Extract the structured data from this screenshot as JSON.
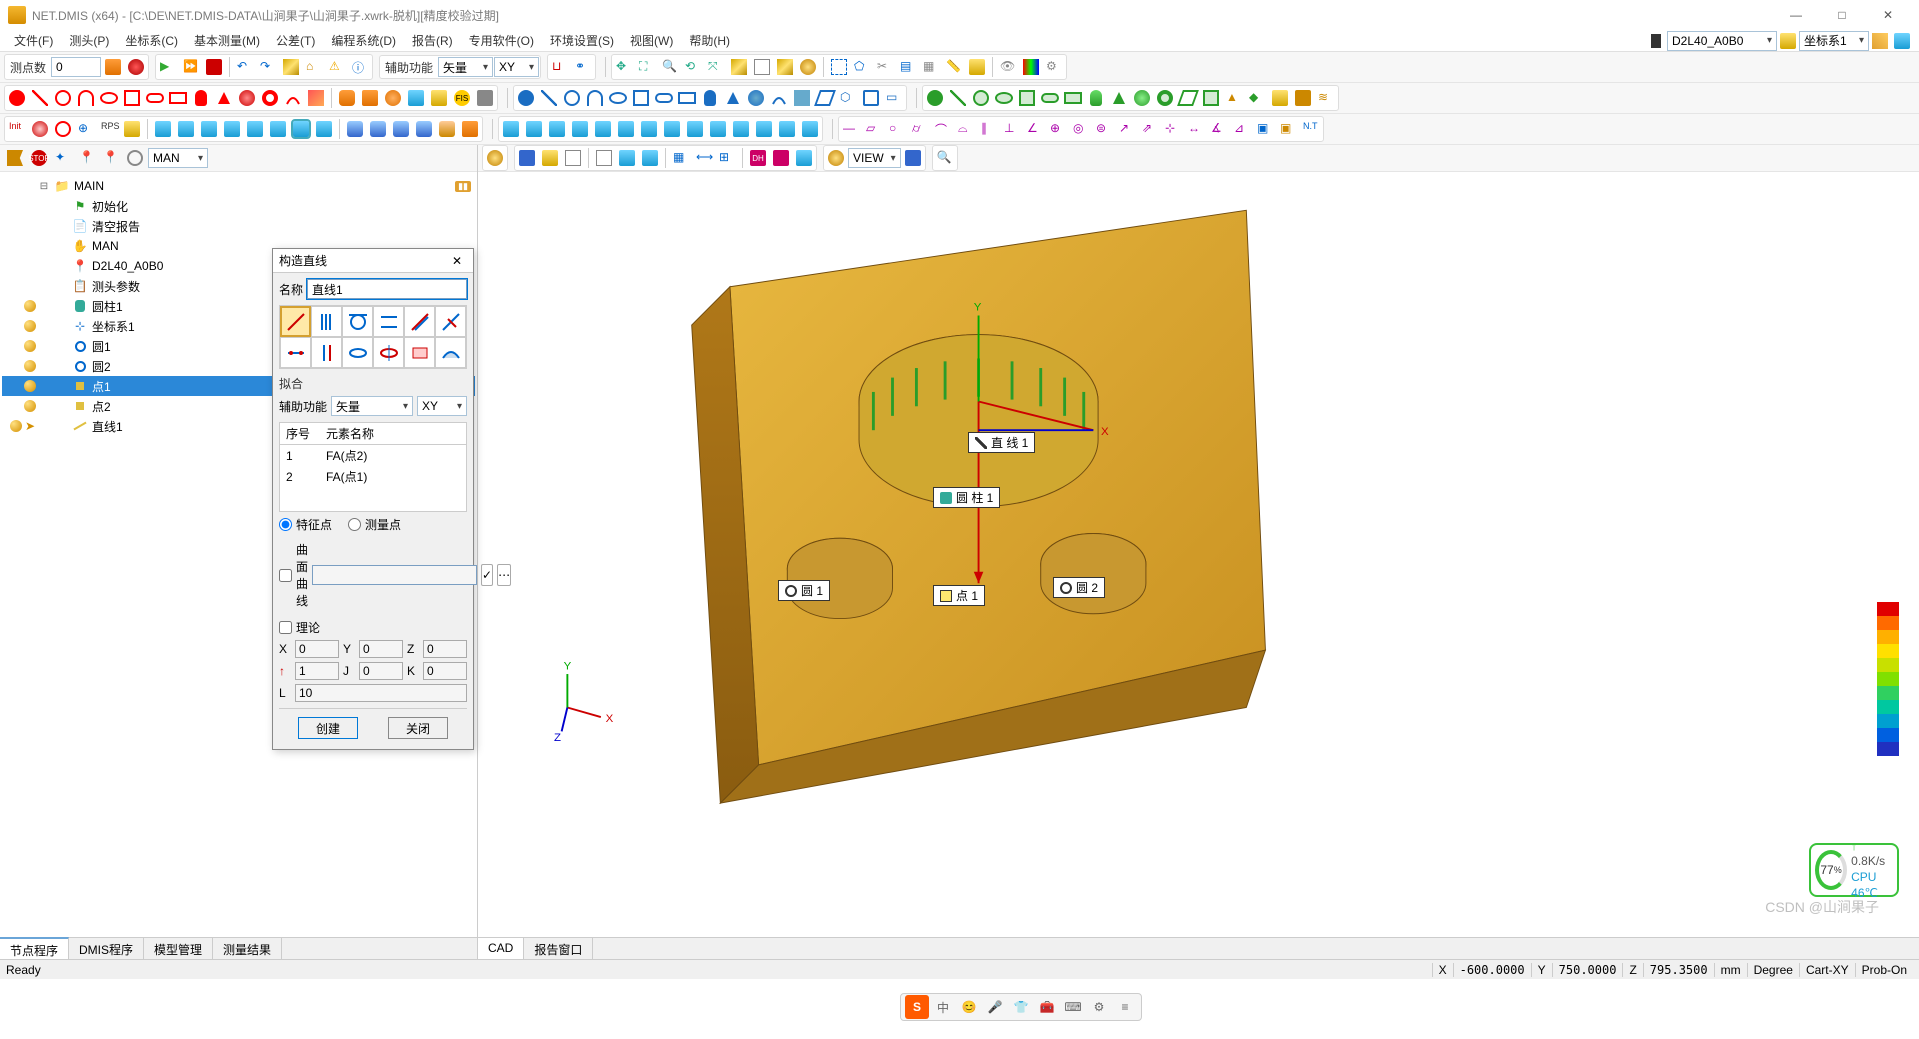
{
  "window": {
    "title": "NET.DMIS (x64) - [C:\\DE\\NET.DMIS-DATA\\山涧果子\\山涧果子.xwrk-脱机][精度校验过期]",
    "min": "—",
    "max": "□",
    "close": "✕"
  },
  "menu": [
    "文件(F)",
    "测头(P)",
    "坐标系(C)",
    "基本测量(M)",
    "公差(T)",
    "编程系统(D)",
    "报告(R)",
    "专用软件(O)",
    "环境设置(S)",
    "视图(W)",
    "帮助(H)"
  ],
  "top_right": {
    "probe_btn": "D2L40_A0B0",
    "cs_btn": "坐标系1"
  },
  "row1": {
    "label_pts": "测点数",
    "pts_value": "0",
    "aux_label": "辅助功能",
    "aux_combo": "矢量",
    "plane_combo": "XY"
  },
  "tree_toolbar": {
    "mode": "MAN"
  },
  "tree": {
    "root": "MAIN",
    "items": [
      {
        "label": "初始化",
        "icon": "green-flag",
        "indent": 1
      },
      {
        "label": "清空报告",
        "icon": "report",
        "indent": 1
      },
      {
        "label": "MAN",
        "icon": "hand",
        "indent": 1
      },
      {
        "label": "D2L40_A0B0",
        "icon": "probe",
        "indent": 1
      },
      {
        "label": "测头参数",
        "icon": "params",
        "indent": 1
      },
      {
        "label": "圆柱1",
        "icon": "cylinder",
        "indent": 1,
        "bulb": true
      },
      {
        "label": "坐标系1",
        "icon": "cs",
        "indent": 1,
        "bulb": true
      },
      {
        "label": "圆1",
        "icon": "circle",
        "indent": 1,
        "bulb": true
      },
      {
        "label": "圆2",
        "icon": "circle",
        "indent": 1,
        "bulb": true
      },
      {
        "label": "点1",
        "icon": "point",
        "indent": 1,
        "bulb": true,
        "selected": true
      },
      {
        "label": "点2",
        "icon": "point",
        "indent": 1,
        "bulb": true
      },
      {
        "label": "直线1",
        "icon": "line",
        "indent": 1,
        "bulb": true,
        "arrow": true
      }
    ]
  },
  "tree_tabs": [
    "节点程序",
    "DMIS程序",
    "模型管理",
    "测量结果"
  ],
  "view_toolbar": {
    "view_combo": "VIEW"
  },
  "view_tabs": [
    "CAD",
    "报告窗口"
  ],
  "viewport_labels": {
    "line1": "直 线 1",
    "cyl1": "圆 柱 1",
    "c1": "圆 1",
    "c2": "圆 2",
    "p1": "点 1"
  },
  "dialog": {
    "title": "构造直线",
    "name_label": "名称",
    "name_value": "直线1",
    "section_fit": "拟合",
    "aux_label": "辅助功能",
    "aux_combo": "矢量",
    "plane_combo": "XY",
    "col_seq": "序号",
    "col_elem": "元素名称",
    "rows": [
      {
        "seq": "1",
        "name": "FA(点2)"
      },
      {
        "seq": "2",
        "name": "FA(点1)"
      }
    ],
    "radio_feature": "特征点",
    "radio_meas": "测量点",
    "check_curve": "曲面曲线",
    "check_theory": "理论",
    "coords": {
      "X": "0",
      "Y": "0",
      "Z": "0",
      "I": "1",
      "J": "0",
      "K": "0",
      "L": "10"
    },
    "arrow": "↑",
    "btn_create": "创建",
    "btn_close": "关闭"
  },
  "status": {
    "ready": "Ready",
    "X": "-600.0000",
    "Y": "750.0000",
    "Z": "795.3500",
    "unit": "mm",
    "ang": "Degree",
    "plane": "Cart-XY",
    "probe": "Prob-On"
  },
  "perf": {
    "pct": "77",
    "pct_suffix": "%",
    "net": "0.8K/s",
    "cpu": "CPU 46℃",
    "arrow": "↑"
  },
  "legend_colors": [
    "#e00000",
    "#ff6a00",
    "#ffb000",
    "#ffe000",
    "#c8e000",
    "#80e000",
    "#30d060",
    "#00c8a0",
    "#00a0d0",
    "#0060e0",
    "#2030c0"
  ],
  "watermark": "CSDN @山涧果子",
  "ime": {
    "S": "S",
    "zh": "中",
    "emoji": "😊"
  },
  "axes": {
    "X": "X",
    "Y": "Y",
    "Z": "Z"
  }
}
